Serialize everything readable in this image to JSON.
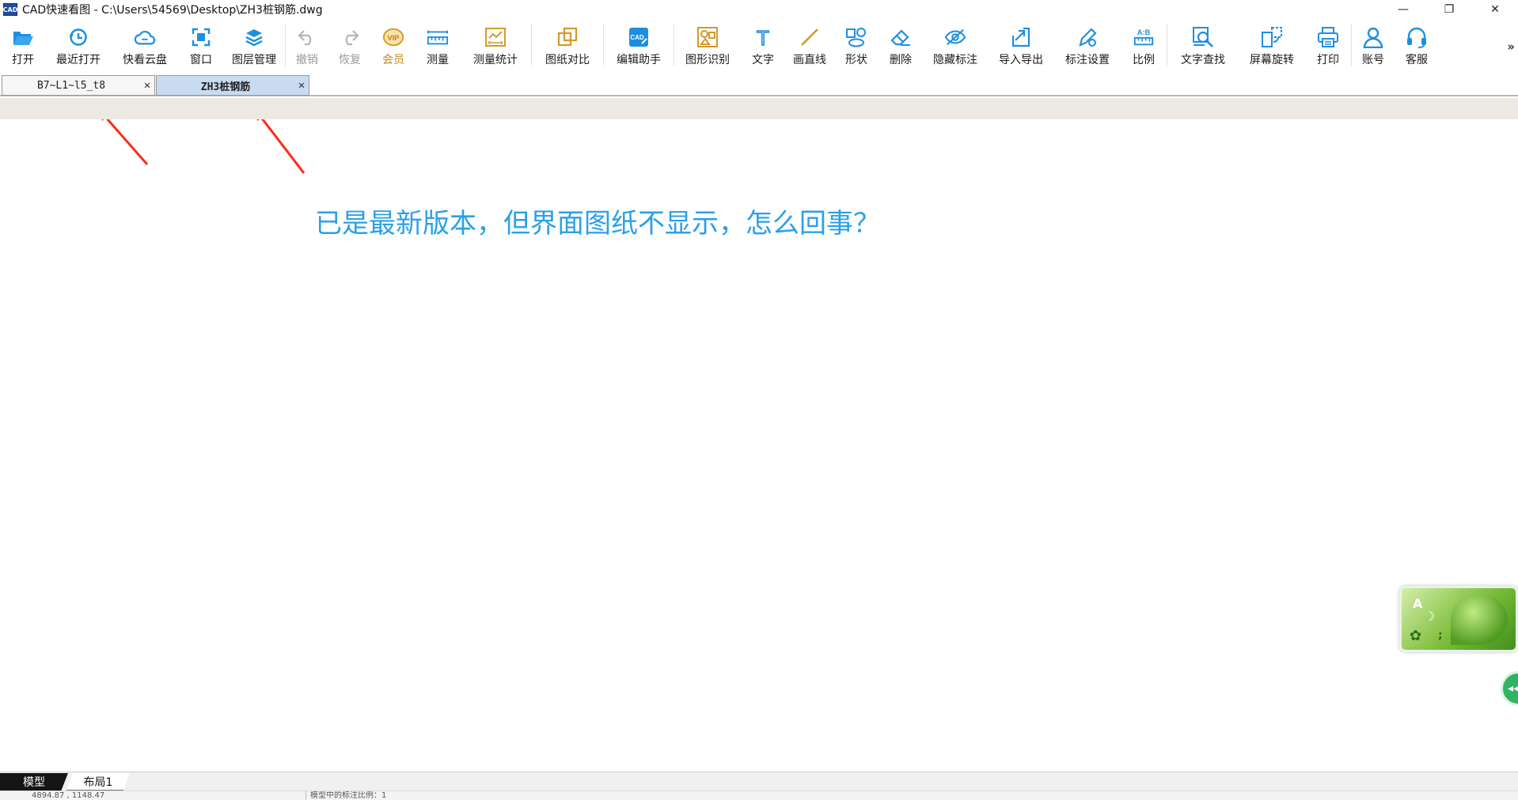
{
  "window": {
    "title": "CAD快速看图 - C:\\Users\\54569\\Desktop\\ZH3桩钢筋.dwg",
    "app_icon": "CAD",
    "minimize": "—",
    "restore": "❐",
    "close": "✕"
  },
  "toolbar": {
    "items": [
      {
        "label": "打开",
        "icon": "folder-open-icon"
      },
      {
        "label": "最近打开",
        "icon": "clock-history-icon"
      },
      {
        "label": "快看云盘",
        "icon": "cloud-icon"
      },
      {
        "label": "窗口",
        "icon": "window-fit-icon"
      },
      {
        "label": "图层管理",
        "icon": "layers-icon"
      },
      {
        "label": "撤销",
        "icon": "undo-icon"
      },
      {
        "label": "恢复",
        "icon": "redo-icon"
      },
      {
        "label": "会员",
        "icon": "vip-badge-icon",
        "badge": "VIP"
      },
      {
        "label": "测量",
        "icon": "ruler-icon"
      },
      {
        "label": "测量统计",
        "icon": "measure-stats-icon"
      },
      {
        "label": "图纸对比",
        "icon": "compare-icon"
      },
      {
        "label": "编辑助手",
        "icon": "edit-assistant-icon",
        "badge": "CAD"
      },
      {
        "label": "图形识别",
        "icon": "shape-recognize-icon"
      },
      {
        "label": "文字",
        "icon": "text-icon",
        "badge": "T"
      },
      {
        "label": "画直线",
        "icon": "line-icon"
      },
      {
        "label": "形状",
        "icon": "shapes-icon"
      },
      {
        "label": "删除",
        "icon": "eraser-icon"
      },
      {
        "label": "隐藏标注",
        "icon": "eye-hidden-icon"
      },
      {
        "label": "导入导出",
        "icon": "import-export-icon"
      },
      {
        "label": "标注设置",
        "icon": "annotation-settings-icon"
      },
      {
        "label": "比例",
        "icon": "scale-icon",
        "badge": "A:B"
      },
      {
        "label": "文字查找",
        "icon": "text-search-icon"
      },
      {
        "label": "屏幕旋转",
        "icon": "rotate-screen-icon"
      },
      {
        "label": "打印",
        "icon": "printer-icon"
      },
      {
        "label": "账号",
        "icon": "user-icon"
      },
      {
        "label": "客服",
        "icon": "headset-icon"
      }
    ],
    "more": "»",
    "colors": {
      "icon_blue": "#1e8fe0",
      "icon_gold": "#d39a2a",
      "disabled": "#b5b5b5"
    }
  },
  "tabs": [
    {
      "label": "B7~L1~l5_t8",
      "close": "✕",
      "active": false
    },
    {
      "label": "ZH3桩钢筋",
      "close": "✕",
      "active": true
    }
  ],
  "canvas": {
    "annotation": "已是最新版本，但界面图纸不显示，怎么回事？",
    "annotation_color": "#2aa0e8",
    "arrow_color": "#ff2a1a"
  },
  "widget": {
    "letter": "A",
    "moon": "☽",
    "gear": "✿",
    "semicolon": ";",
    "round_button": "◂◂"
  },
  "layout_tabs": [
    {
      "label": "模型",
      "active": true
    },
    {
      "label": "布局1",
      "active": false
    }
  ],
  "status": {
    "coords": "4894.87 , 1148.47",
    "scale_text": "模型中的标注比例：1"
  }
}
